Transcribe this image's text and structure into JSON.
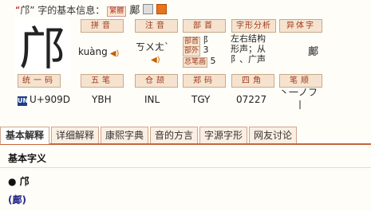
{
  "header": {
    "title_quote_open": "“",
    "char": "邝",
    "title_rest": "” 字的基本信息：",
    "badge": "繁體",
    "variant_char": "鄺"
  },
  "big_char": "邝",
  "row1": {
    "pinyin_label": "拼音",
    "pinyin_value": "kuàng",
    "zhuyin_label": "注音",
    "zhuyin_value": "ㄎㄨㄤˋ",
    "bushou_label": "部首",
    "bushou_inner_label": "部首",
    "bushou_value": "阝",
    "bushouwai_label": "部外",
    "bushouwai_value": "3",
    "zongbihua_label": "总笔画",
    "zongbihua_value": "5",
    "zixing_label": "字形分析",
    "zixing_value_line1": "左右结构",
    "zixing_value_line2": "形声；从",
    "zixing_value_line3": "阝、广声",
    "yiti_label": "异体字",
    "yiti_value": "鄺"
  },
  "row2": {
    "unicode_label": "统一码",
    "unicode_value": "U+909D",
    "unicode_icon": "UN",
    "wubi_label": "五笔",
    "wubi_value": "YBH",
    "cangjie_label": "仓颉",
    "cangjie_value": "INL",
    "zhengma_label": "郑码",
    "zhengma_value": "TGY",
    "sijiao_label": "四角",
    "sijiao_value": "07227",
    "bishun_label": "笔顺",
    "bishun_value_line1": "丶一ノフ",
    "bishun_value_line2": "丨"
  },
  "tabs": [
    "基本解释",
    "详细解释",
    "康熙字典",
    "音的方言",
    "字源字形",
    "网友讨论"
  ],
  "active_tab": 0,
  "content": {
    "section_title": "基本字义",
    "bullet_char": "邝",
    "traditional": "(鄺)"
  }
}
